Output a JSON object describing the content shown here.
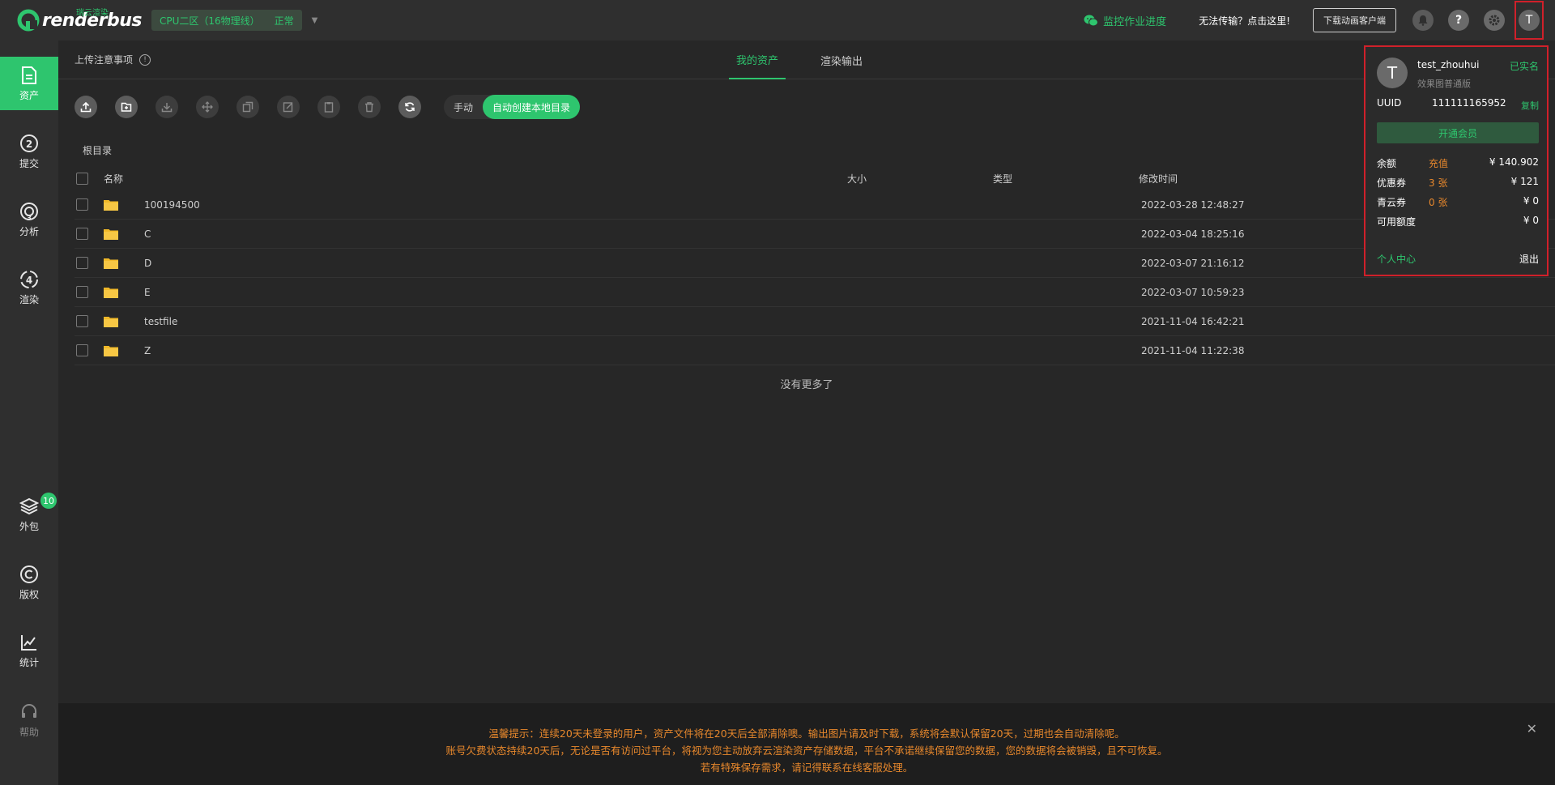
{
  "brand": {
    "name": "renderbus",
    "tagline": "瑞云渲染"
  },
  "zone": {
    "name": "CPU二区（16物理线）",
    "status": "正常"
  },
  "header": {
    "monitor": "监控作业进度",
    "cannot_transfer": "无法传输？点击这里!",
    "download_client": "下载动画客户端",
    "help_glyph": "?",
    "avatar_letter": "T"
  },
  "sidebar": {
    "items": [
      {
        "label": "资产"
      },
      {
        "label": "提交"
      },
      {
        "label": "分析"
      },
      {
        "label": "渲染"
      },
      {
        "label": "外包",
        "badge": "10"
      },
      {
        "label": "版权"
      },
      {
        "label": "统计"
      },
      {
        "label": "帮助"
      }
    ]
  },
  "subbar": {
    "upload_notice": "上传注意事项",
    "tabs": [
      {
        "label": "我的资产"
      },
      {
        "label": "渲染输出"
      }
    ]
  },
  "toolbar": {
    "manual": "手动",
    "auto": "自动创建本地目录"
  },
  "breadcrumb": "根目录",
  "table": {
    "columns": {
      "name": "名称",
      "size": "大小",
      "type": "类型",
      "mtime": "修改时间"
    },
    "rows": [
      {
        "name": "100194500",
        "mtime": "2022-03-28 12:48:27"
      },
      {
        "name": "C",
        "mtime": "2022-03-04 18:25:16"
      },
      {
        "name": "D",
        "mtime": "2022-03-07 21:16:12"
      },
      {
        "name": "E",
        "mtime": "2022-03-07 10:59:23"
      },
      {
        "name": "testfile",
        "mtime": "2021-11-04 16:42:21"
      },
      {
        "name": "Z",
        "mtime": "2021-11-04 11:22:38"
      }
    ],
    "no_more": "没有更多了"
  },
  "notice": {
    "line1": "温馨提示：连续20天未登录的用户，资产文件将在20天后全部清除噢。输出图片请及时下载，系统将会默认保留20天，过期也会自动清除呢。",
    "line2": "账号欠费状态持续20天后，无论是否有访问过平台，将视为您主动放弃云渲染资产存储数据，平台不承诺继续保留您的数据，您的数据将会被销毁，且不可恢复。",
    "line3": "若有特殊保存需求，请记得联系在线客服处理。",
    "close_glyph": "✕"
  },
  "user_popup": {
    "avatar_letter": "T",
    "username": "test_zhouhui",
    "plan": "效果图普通版",
    "verified": "已实名",
    "uuid_label": "UUID",
    "uuid": "111111165952",
    "copy": "复制",
    "vip": "开通会员",
    "balance_label": "余额",
    "recharge": "充值",
    "balance": "¥ 140.902",
    "coupon_label": "优惠券",
    "coupon_count": "3 张",
    "coupon_amount": "¥ 121",
    "qingyun_label": "青云券",
    "qingyun_count": "0 张",
    "qingyun_amount": "¥ 0",
    "credit_label": "可用额度",
    "credit_amount": "¥ 0",
    "personal_center": "个人中心",
    "logout": "退出"
  },
  "colors": {
    "accent": "#2ec56e",
    "warning": "#e8882c",
    "highlight": "#d0202a"
  }
}
